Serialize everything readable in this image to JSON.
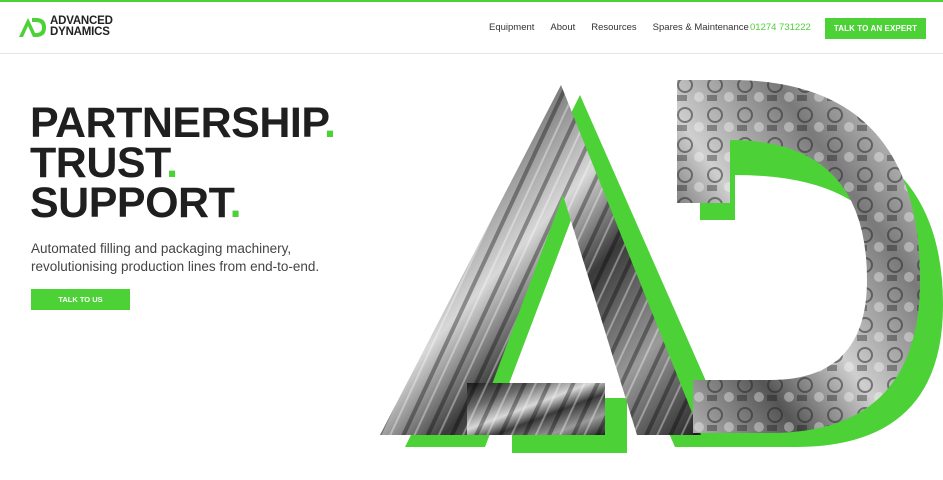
{
  "brand": {
    "line1": "ADVANCED",
    "line2": "DYNAMICS",
    "accent_color": "#4cd137",
    "logo_icon": "ad-monogram-icon"
  },
  "nav": {
    "items": [
      {
        "label": "Equipment"
      },
      {
        "label": "About"
      },
      {
        "label": "Resources"
      },
      {
        "label": "Spares & Maintenance"
      }
    ],
    "phone": "01274 731222",
    "cta": "TALK TO AN EXPERT"
  },
  "hero": {
    "title_lines": [
      {
        "text": "PARTNERSHIP",
        "dot": "."
      },
      {
        "text": "TRUST",
        "dot": "."
      },
      {
        "text": "SUPPORT",
        "dot": "."
      }
    ],
    "subtitle_lines": [
      "Automated filling and packaging machinery,",
      "revolutionising production lines from end-to-end."
    ],
    "cta": "TALK TO US",
    "graphic_icon": "ad-monogram-machinery-graphic"
  }
}
